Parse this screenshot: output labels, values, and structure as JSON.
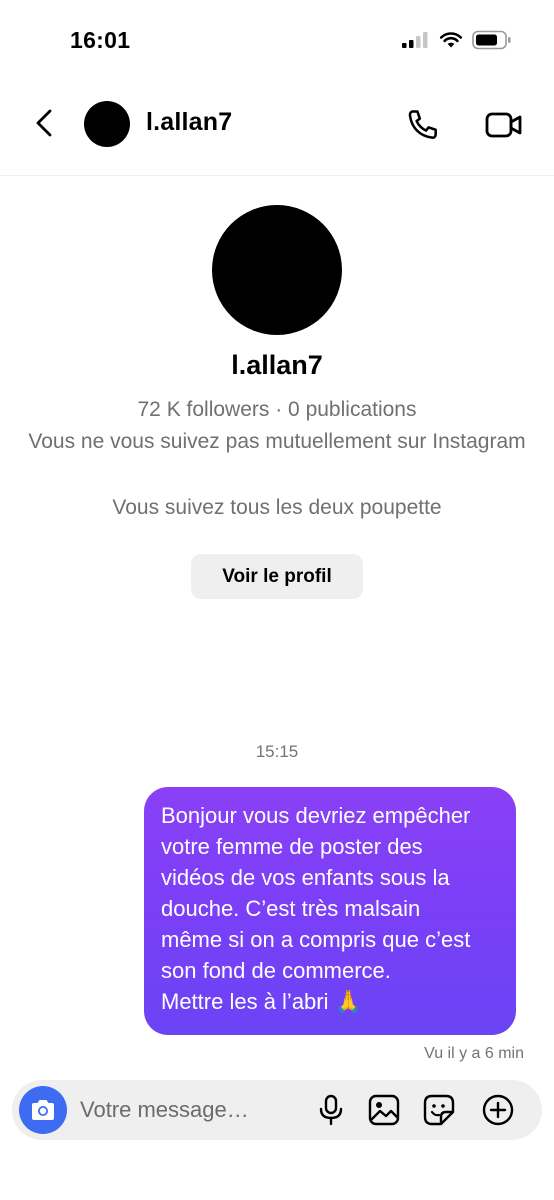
{
  "status_bar": {
    "time": "16:01"
  },
  "header": {
    "username": "l.allan7"
  },
  "profile": {
    "username": "l.allan7",
    "stats": "72 K followers · 0 publications",
    "mutual_info": "Vous ne vous suivez pas mutuellement sur Instagram",
    "common_follow": "Vous suivez tous les deux poupette",
    "view_profile_label": "Voir le profil"
  },
  "conversation": {
    "timestamp": "15:15",
    "messages": [
      {
        "from": "me",
        "text": "Bonjour vous devriez empêcher\nvotre femme de poster des\nvidéos de vos enfants sous la\ndouche. C’est très malsain\nmême si on a compris que c’est\nson fond de commerce.\nMettre les à l’abri 🙏"
      }
    ],
    "seen_status": "Vu il y a 6 min"
  },
  "composer": {
    "placeholder": "Votre message…"
  },
  "icons": {
    "back": "chevron-left-icon",
    "call": "phone-icon",
    "video": "video-camera-icon",
    "camera": "camera-icon",
    "mic": "microphone-icon",
    "gallery": "image-icon",
    "sticker": "sticker-icon",
    "plus": "plus-circle-icon"
  },
  "colors": {
    "bubble_start": "#8a40f6",
    "bubble_end": "#6a44f5",
    "camera_button": "#3d6cf3",
    "secondary_text": "#707070"
  }
}
